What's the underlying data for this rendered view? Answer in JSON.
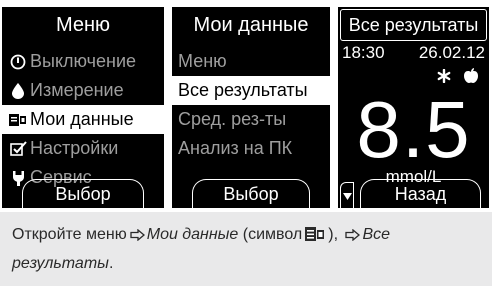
{
  "screens": {
    "menu": {
      "title": "Меню",
      "items": [
        {
          "label": "Выключение",
          "icon": "power-icon",
          "selected": false
        },
        {
          "label": "Измерение",
          "icon": "drop-icon",
          "selected": false
        },
        {
          "label": "Мои данные",
          "icon": "my-data-icon",
          "selected": true
        },
        {
          "label": "Настройки",
          "icon": "settings-check-icon",
          "selected": false
        },
        {
          "label": "Сервис",
          "icon": "service-icon",
          "selected": false
        }
      ],
      "softkey": "Выбор"
    },
    "my_data": {
      "title": "Мои данные",
      "items": [
        {
          "label": "Меню",
          "selected": false
        },
        {
          "label": "Все результаты",
          "selected": true
        },
        {
          "label": "Сред. рез-ты",
          "selected": false
        },
        {
          "label": "Анализ на ПК",
          "selected": false
        }
      ],
      "softkey": "Выбор"
    },
    "all_results": {
      "title": "Все результаты",
      "time": "18:30",
      "date": "26.02.12",
      "marks": [
        "asterisk-icon",
        "apple-icon"
      ],
      "value": "8.5",
      "unit": "mmol/L",
      "softkey": "Назад"
    }
  },
  "caption": {
    "prefix": "Откройте меню",
    "my_data": "Мои данные",
    "symbol_open": "(символ",
    "symbol_close": "),",
    "all_results": "Все результаты",
    "suffix": "."
  },
  "colors": {
    "screen_bg": "#000000",
    "screen_text": "#ffffff",
    "inactive_item": "#9e9e9e",
    "caption_bg": "#e9e9ea"
  }
}
